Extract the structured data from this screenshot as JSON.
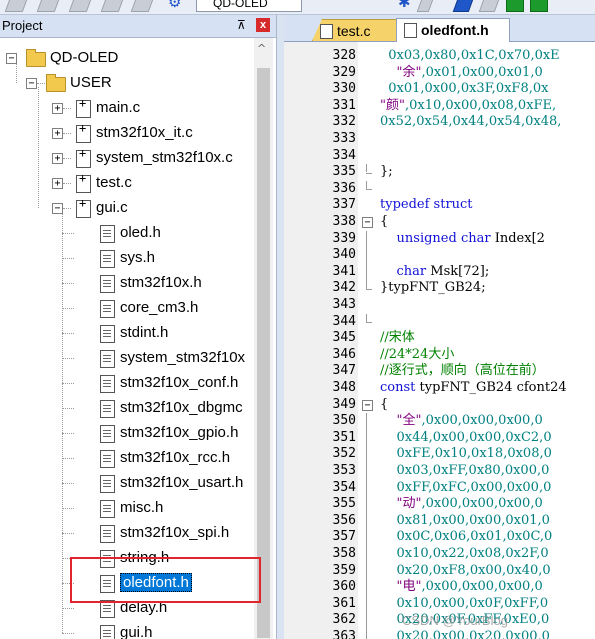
{
  "toolbar": {
    "target_name": "QD-OLED"
  },
  "project_panel": {
    "title": "Project",
    "pin": "⊼",
    "close": "x",
    "tree": [
      {
        "label": "QD-OLED",
        "level": 0,
        "type": "root",
        "expander": "⊟"
      },
      {
        "label": "USER",
        "level": 1,
        "type": "folder",
        "expander": "⊟"
      },
      {
        "label": "main.c",
        "level": 2,
        "type": "c",
        "expander": "+"
      },
      {
        "label": "stm32f10x_it.c",
        "level": 2,
        "type": "c",
        "expander": "+"
      },
      {
        "label": "system_stm32f10x.c",
        "level": 2,
        "type": "c",
        "expander": "+"
      },
      {
        "label": "test.c",
        "level": 2,
        "type": "c",
        "expander": "+"
      },
      {
        "label": "gui.c",
        "level": 2,
        "type": "c",
        "expander": "−"
      },
      {
        "label": "oled.h",
        "level": 3,
        "type": "h"
      },
      {
        "label": "sys.h",
        "level": 3,
        "type": "h"
      },
      {
        "label": "stm32f10x.h",
        "level": 3,
        "type": "h"
      },
      {
        "label": "core_cm3.h",
        "level": 3,
        "type": "h"
      },
      {
        "label": "stdint.h",
        "level": 3,
        "type": "h"
      },
      {
        "label": "system_stm32f10x",
        "level": 3,
        "type": "h"
      },
      {
        "label": "stm32f10x_conf.h",
        "level": 3,
        "type": "h"
      },
      {
        "label": "stm32f10x_dbgmc",
        "level": 3,
        "type": "h"
      },
      {
        "label": "stm32f10x_gpio.h",
        "level": 3,
        "type": "h"
      },
      {
        "label": "stm32f10x_rcc.h",
        "level": 3,
        "type": "h"
      },
      {
        "label": "stm32f10x_usart.h",
        "level": 3,
        "type": "h"
      },
      {
        "label": "misc.h",
        "level": 3,
        "type": "h"
      },
      {
        "label": "stm32f10x_spi.h",
        "level": 3,
        "type": "h"
      },
      {
        "label": "string.h",
        "level": 3,
        "type": "h"
      },
      {
        "label": "oledfont.h",
        "level": 3,
        "type": "h",
        "selected": true
      },
      {
        "label": "delay.h",
        "level": 3,
        "type": "h"
      },
      {
        "label": "gui.h",
        "level": 3,
        "type": "h"
      }
    ]
  },
  "editor": {
    "tabs": [
      {
        "label": "test.c",
        "active": false
      },
      {
        "label": "oledfont.h",
        "active": true
      }
    ],
    "lines": [
      {
        "n": "328",
        "fold": "",
        "parts": [
          [
            "hex",
            "  0x03,0x80,0x1C,0x70,0xE"
          ]
        ]
      },
      {
        "n": "329",
        "fold": "",
        "parts": [
          [
            "str",
            "    \"余\""
          ],
          [
            "hex",
            ",0x01,0x00,0x01,0"
          ]
        ]
      },
      {
        "n": "330",
        "fold": "",
        "parts": [
          [
            "hex",
            "  0x01,0x00,0x3F,0xF8,0x"
          ]
        ]
      },
      {
        "n": "331",
        "fold": "",
        "parts": [
          [
            "str",
            "\"颜\""
          ],
          [
            "hex",
            ",0x10,0x00,0x08,0xFE,"
          ]
        ]
      },
      {
        "n": "332",
        "fold": "",
        "parts": [
          [
            "hex",
            "0x52,0x54,0x44,0x54,0x48,"
          ]
        ]
      },
      {
        "n": "333",
        "fold": "",
        "parts": []
      },
      {
        "n": "334",
        "fold": "",
        "parts": []
      },
      {
        "n": "335",
        "fold": "end",
        "parts": [
          [
            "plain",
            "};"
          ]
        ]
      },
      {
        "n": "336",
        "fold": "tick",
        "parts": []
      },
      {
        "n": "337",
        "fold": "",
        "parts": [
          [
            "kw",
            "typedef struct"
          ]
        ]
      },
      {
        "n": "338",
        "fold": "box",
        "parts": [
          [
            "plain",
            "{"
          ]
        ]
      },
      {
        "n": "339",
        "fold": "line",
        "parts": [
          [
            "kw",
            "    unsigned char"
          ],
          [
            "plain",
            " Index[2"
          ]
        ]
      },
      {
        "n": "340",
        "fold": "line",
        "parts": []
      },
      {
        "n": "341",
        "fold": "line",
        "parts": [
          [
            "kw",
            "    char"
          ],
          [
            "plain",
            " Msk[72];"
          ]
        ]
      },
      {
        "n": "342",
        "fold": "end",
        "parts": [
          [
            "plain",
            "}typFNT_GB24;"
          ]
        ]
      },
      {
        "n": "343",
        "fold": "",
        "parts": []
      },
      {
        "n": "344",
        "fold": "tick",
        "parts": []
      },
      {
        "n": "345",
        "fold": "",
        "parts": [
          [
            "cmt",
            "//宋体"
          ]
        ]
      },
      {
        "n": "346",
        "fold": "",
        "parts": [
          [
            "cmt",
            "//24*24大小"
          ]
        ]
      },
      {
        "n": "347",
        "fold": "",
        "parts": [
          [
            "cmt",
            "//逐行式，顺向（高位在前）"
          ]
        ]
      },
      {
        "n": "348",
        "fold": "",
        "parts": [
          [
            "kw",
            "const"
          ],
          [
            "plain",
            " typFNT_GB24 cfont24"
          ]
        ]
      },
      {
        "n": "349",
        "fold": "box",
        "parts": [
          [
            "plain",
            "{"
          ]
        ]
      },
      {
        "n": "350",
        "fold": "line",
        "parts": [
          [
            "str",
            "    \"全\""
          ],
          [
            "hex",
            ",0x00,0x00,0x00,0"
          ]
        ]
      },
      {
        "n": "351",
        "fold": "line",
        "parts": [
          [
            "hex",
            "    0x44,0x00,0x00,0xC2,0"
          ]
        ]
      },
      {
        "n": "352",
        "fold": "line",
        "parts": [
          [
            "hex",
            "    0xFE,0x10,0x18,0x08,0"
          ]
        ]
      },
      {
        "n": "353",
        "fold": "line",
        "parts": [
          [
            "hex",
            "    0x03,0xFF,0x80,0x00,0"
          ]
        ]
      },
      {
        "n": "354",
        "fold": "line",
        "parts": [
          [
            "hex",
            "    0xFF,0xFC,0x00,0x00,0"
          ]
        ]
      },
      {
        "n": "355",
        "fold": "line",
        "parts": [
          [
            "str",
            "    \"动\""
          ],
          [
            "hex",
            ",0x00,0x00,0x00,0"
          ]
        ]
      },
      {
        "n": "356",
        "fold": "line",
        "parts": [
          [
            "hex",
            "    0x81,0x00,0x00,0x01,0"
          ]
        ]
      },
      {
        "n": "357",
        "fold": "line",
        "parts": [
          [
            "hex",
            "    0x0C,0x06,0x01,0x0C,0"
          ]
        ]
      },
      {
        "n": "358",
        "fold": "line",
        "parts": [
          [
            "hex",
            "    0x10,0x22,0x08,0x2F,0"
          ]
        ]
      },
      {
        "n": "359",
        "fold": "line",
        "parts": [
          [
            "hex",
            "    0x20,0xF8,0x00,0x40,0"
          ]
        ]
      },
      {
        "n": "360",
        "fold": "line",
        "parts": [
          [
            "str",
            "    \"电\""
          ],
          [
            "hex",
            ",0x00,0x00,0x00,0"
          ]
        ]
      },
      {
        "n": "361",
        "fold": "line",
        "parts": [
          [
            "hex",
            "    0x10,0x00,0x0F,0xFF,0"
          ]
        ]
      },
      {
        "n": "362",
        "fold": "line",
        "parts": [
          [
            "hex",
            "    0x20,0x0F,0xFF,0xE0,0"
          ]
        ]
      },
      {
        "n": "363",
        "fold": "line",
        "parts": [
          [
            "hex",
            "    0x20,0x00,0x20,0x00,0"
          ]
        ]
      }
    ]
  },
  "watermark": "CSDN @YourBlog"
}
